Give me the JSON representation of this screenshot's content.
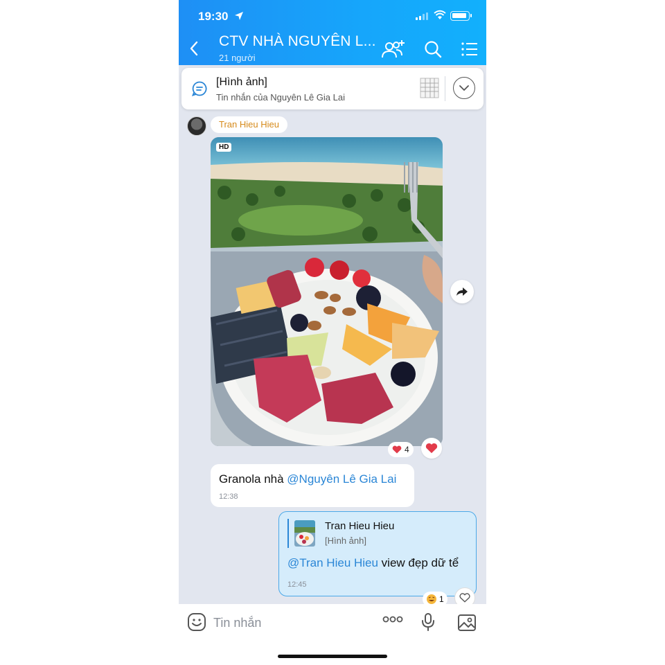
{
  "status_bar": {
    "time": "19:30"
  },
  "header": {
    "title": "CTV NHÀ NGUYÊN L...",
    "subtitle": "21 người",
    "accent_color": "#1e8ff5"
  },
  "pinned_message": {
    "title": "[Hình ảnh]",
    "subtitle": "Tin nhắn của Nguyên Lê Gia Lai"
  },
  "messages": [
    {
      "sender": "Tran Hieu Hieu",
      "image_badge": "HD",
      "image_description": "photo",
      "image_reaction_count": "4"
    },
    {
      "text_plain": "Granola nhà ",
      "mention": "@Nguyên Lê Gia Lai",
      "time": "12:38"
    },
    {
      "quoted_name": "Tran Hieu Hieu",
      "quoted_type": "[Hình ảnh]",
      "mention": "@Tran Hieu Hieu",
      "text_plain": " view đẹp dữ tể",
      "time": "12:45",
      "reaction_count": "1"
    }
  ],
  "input": {
    "placeholder": "Tin nhắn"
  },
  "icons": [
    "back-icon",
    "add-member-icon",
    "search-icon",
    "menu-icon",
    "pin-message-icon",
    "chevron-down-icon",
    "forward-icon",
    "heart-icon",
    "emoji-icon",
    "more-icon",
    "mic-icon",
    "gallery-icon"
  ]
}
